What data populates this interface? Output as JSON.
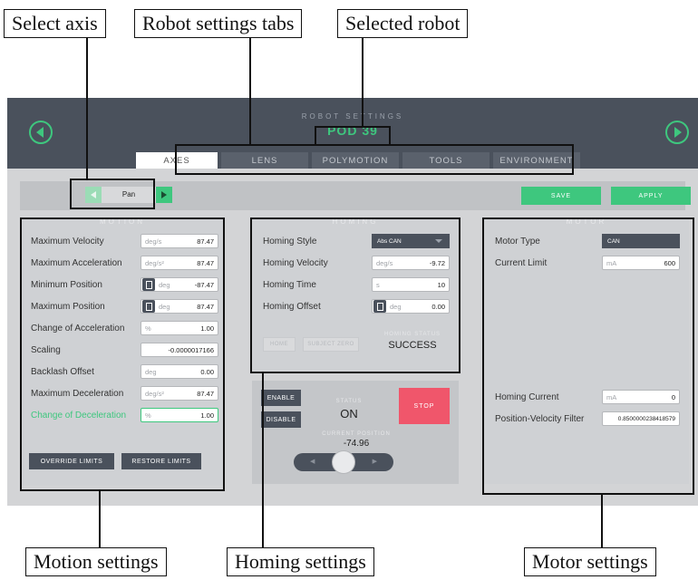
{
  "callouts": {
    "select_axis": "Select axis",
    "robot_settings_tabs": "Robot settings tabs",
    "selected_robot": "Selected robot",
    "motion_settings": "Motion settings",
    "homing_settings": "Homing settings",
    "motor_settings": "Motor settings"
  },
  "header": {
    "title": "ROBOT SETTINGS",
    "robot_name": "POD 39",
    "prev_icon": "chevron-left-circle-icon",
    "next_icon": "chevron-right-circle-icon"
  },
  "tabs": [
    {
      "label": "AXES",
      "active": true
    },
    {
      "label": "LENS",
      "active": false
    },
    {
      "label": "POLYMOTION",
      "active": false
    },
    {
      "label": "TOOLS",
      "active": false
    },
    {
      "label": "ENVIRONMENT",
      "active": false
    }
  ],
  "axis_selector": {
    "value": "Pan"
  },
  "actions": {
    "save": "SAVE",
    "apply": "APPLY"
  },
  "motion": {
    "title": "MOTION",
    "rows": [
      {
        "label": "Maximum Velocity",
        "unit": "deg/s",
        "value": "87.47"
      },
      {
        "label": "Maximum Acceleration",
        "unit": "deg/s²",
        "value": "87.47"
      },
      {
        "label": "Minimum Position",
        "unit": "deg",
        "value": "-87.47",
        "lock": true
      },
      {
        "label": "Maximum Position",
        "unit": "deg",
        "value": "87.47",
        "lock": true
      },
      {
        "label": "Change of Acceleration",
        "unit": "%",
        "value": "1.00"
      },
      {
        "label": "Scaling",
        "unit": "",
        "value": "-0.0000017166"
      },
      {
        "label": "Backlash Offset",
        "unit": "deg",
        "value": "0.00"
      },
      {
        "label": "Maximum Deceleration",
        "unit": "deg/s²",
        "value": "87.47"
      },
      {
        "label": "Change of Deceleration",
        "unit": "%",
        "value": "1.00",
        "highlight": true
      }
    ],
    "override_limits": "OVERRIDE LIMITS",
    "restore_limits": "RESTORE LIMITS"
  },
  "homing": {
    "title": "HOMING",
    "style_label": "Homing Style",
    "style_value": "Abs CAN",
    "velocity_label": "Homing Velocity",
    "velocity_unit": "deg/s",
    "velocity_value": "-9.72",
    "time_label": "Homing Time",
    "time_unit": "s",
    "time_value": "10",
    "offset_label": "Homing Offset",
    "offset_unit": "deg",
    "offset_value": "0.00",
    "home_btn": "HOME",
    "subject_zero_btn": "SUBJECT ZERO",
    "status_label": "HOMING STATUS",
    "status_value": "SUCCESS"
  },
  "control": {
    "enable": "ENABLE",
    "disable": "DISABLE",
    "status_label": "STATUS",
    "status_value": "ON",
    "stop": "STOP",
    "position_label": "CURRENT POSITION",
    "position_value": "-74.96"
  },
  "motor": {
    "title": "MOTOR",
    "type_label": "Motor Type",
    "type_value": "CAN",
    "current_limit_label": "Current Limit",
    "current_limit_unit": "mA",
    "current_limit_value": "600",
    "homing_current_label": "Homing Current",
    "homing_current_unit": "mA",
    "homing_current_value": "0",
    "filter_label": "Position-Velocity Filter",
    "filter_value": "0.8500000238418579"
  },
  "colors": {
    "accent": "#3ec77e",
    "stop": "#f0566b",
    "header_bg": "#4a515c"
  }
}
